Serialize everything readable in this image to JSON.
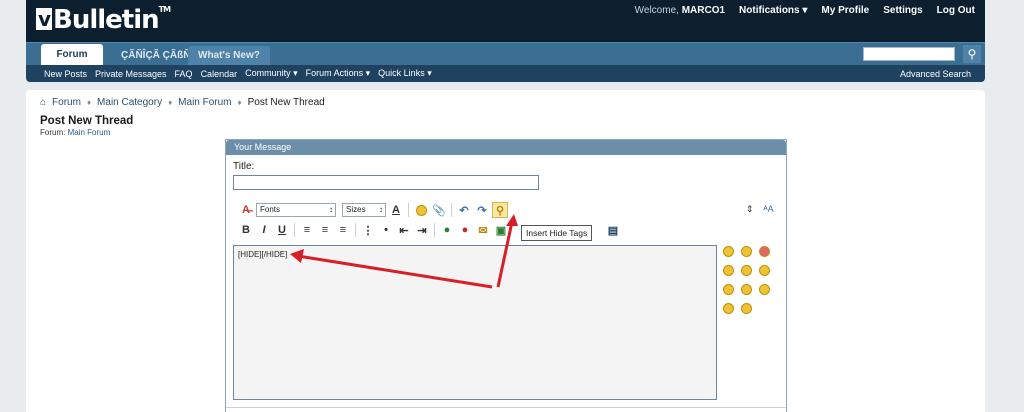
{
  "header": {
    "logo": "Bulletin",
    "logo_mark": "v",
    "tm": "TM",
    "welcome": "Welcome,",
    "user": "MARCO1",
    "links": [
      "Notifications",
      "My Profile",
      "Settings",
      "Log Out"
    ]
  },
  "tabs": [
    "Forum",
    "ÇÃÑÎÇÃ ÇÃßÑÎÃ",
    "What's New?"
  ],
  "subnav": {
    "items": [
      "New Posts",
      "Private Messages",
      "FAQ",
      "Calendar",
      "Community ▾",
      "Forum Actions ▾",
      "Quick Links ▾"
    ],
    "advanced": "Advanced Search"
  },
  "breadcrumb": [
    "Forum",
    "Main Category",
    "Main Forum",
    "Post New Thread"
  ],
  "page": {
    "title": "Post New Thread",
    "forum_label": "Forum:",
    "forum_name": "Main Forum"
  },
  "editor": {
    "box_title": "Your Message",
    "title_label": "Title:",
    "fonts": "Fonts",
    "sizes": "Sizes",
    "tooltip": "Insert Hide Tags",
    "content": "[HIDE][/HIDE]"
  },
  "colors": {
    "header": "#0b1f2e",
    "tabbar": "#3b6e93",
    "subnav": "#1e4260",
    "arrow": "#d81f26"
  }
}
